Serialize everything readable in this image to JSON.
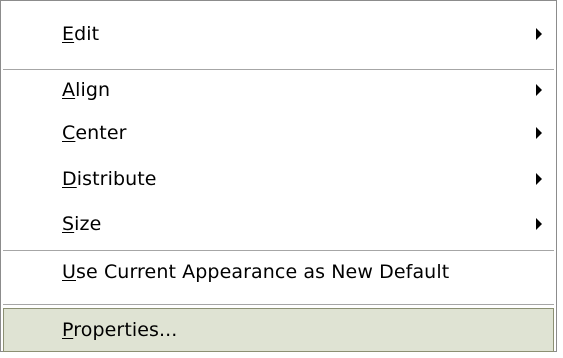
{
  "menu": {
    "items": [
      {
        "pre": "",
        "key": "E",
        "post": "dit",
        "submenu": true
      },
      {
        "pre": "",
        "key": "A",
        "post": "lign",
        "submenu": true
      },
      {
        "pre": "",
        "key": "C",
        "post": "enter",
        "submenu": true
      },
      {
        "pre": "",
        "key": "D",
        "post": "istribute",
        "submenu": true
      },
      {
        "pre": "",
        "key": "S",
        "post": "ize",
        "submenu": true
      },
      {
        "pre": "",
        "key": "U",
        "post": "se Current Appearance as New Default",
        "submenu": false
      },
      {
        "pre": "",
        "key": "P",
        "post": "roperties...",
        "submenu": false,
        "highlighted": true
      }
    ],
    "colors": {
      "highlight_bg": "#dfe3d3",
      "highlight_border": "#8c9073",
      "separator": "#a6a6a6",
      "border": "#8c8c8c"
    },
    "icons": {
      "submenu_arrow": "triangle-right"
    }
  }
}
